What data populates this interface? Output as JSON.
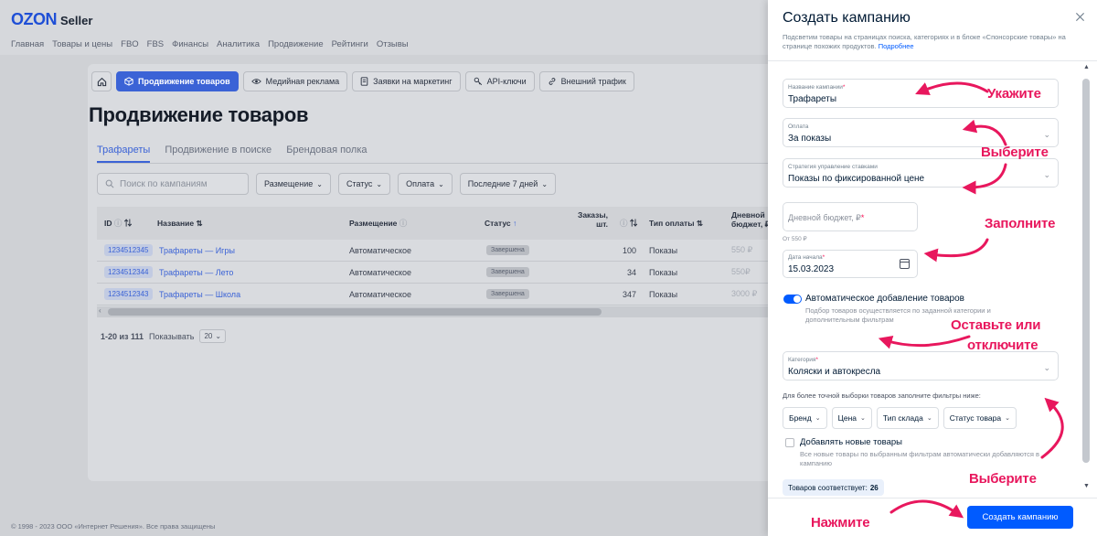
{
  "logo": {
    "brand": "OZON",
    "product": "Seller"
  },
  "top_nav": [
    "Главная",
    "Товары и цены",
    "FBO",
    "FBS",
    "Финансы",
    "Аналитика",
    "Продвижение",
    "Рейтинги",
    "Отзывы"
  ],
  "sub_nav": {
    "items": [
      "Продвижение товаров",
      "Медийная реклама",
      "Заявки на маркетинг",
      "API-ключи",
      "Внешний трафик"
    ]
  },
  "page_title": "Продвижение товаров",
  "tabs": [
    "Трафареты",
    "Продвижение в поиске",
    "Брендовая полка"
  ],
  "filters": {
    "search_placeholder": "Поиск по кампаниям",
    "buttons": [
      "Размещение",
      "Статус",
      "Оплата",
      "Последние 7 дней"
    ]
  },
  "table": {
    "headers": {
      "id": "ID",
      "name": "Название",
      "placement": "Размещение",
      "status": "Статус",
      "orders_l1": "Заказы,",
      "orders_l2": "шт.",
      "pay_type": "Тип оплаты",
      "budget_l1": "Дневной",
      "budget_l2": "бюджет, ₽"
    },
    "rows": [
      {
        "id": "1234512345",
        "name": "Трафареты — Игры",
        "placement": "Автоматическое",
        "status": "Завершена",
        "orders": "100",
        "pay_type": "Показы",
        "budget": "550 ₽"
      },
      {
        "id": "1234512344",
        "name": "Трафареты — Лето",
        "placement": "Автоматическое",
        "status": "Завершена",
        "orders": "34",
        "pay_type": "Показы",
        "budget": "550₽"
      },
      {
        "id": "1234512343",
        "name": "Трафареты — Школа",
        "placement": "Автоматическое",
        "status": "Завершена",
        "orders": "347",
        "pay_type": "Показы",
        "budget": "3000 ₽"
      }
    ]
  },
  "pager": {
    "range": "1-20 из 111",
    "show_label": "Показывать",
    "page_size": "20"
  },
  "footer": "© 1998 - 2023 ООО «Интернет Решения». Все права защищены",
  "drawer": {
    "title": "Создать кампанию",
    "description": "Подсветим товары на страницах поиска, категориях и в блоке «Спонсорские товары» на странице похожих продуктов.",
    "more_link": "Подробнее",
    "campaign_name": {
      "label": "Название кампании",
      "value": "Трафареты"
    },
    "payment": {
      "label": "Оплата",
      "value": "За показы"
    },
    "strategy": {
      "label": "Стратегия управление ставками",
      "value": "Показы по фиксированной цене"
    },
    "budget": {
      "placeholder": "Дневной бюджет, ₽",
      "hint": "От 550 ₽"
    },
    "start_date": {
      "label": "Дата начала",
      "value": "15.03.2023"
    },
    "auto_add": {
      "label": "Автоматическое добавление товаров",
      "description": "Подбор товаров осуществляется по заданной категории и дополнительным фильтрам",
      "enabled": true
    },
    "category": {
      "label": "Категория",
      "value": "Коляски и автокресла"
    },
    "filters_hint": "Для более точной выборки товаров заполните фильтры ниже:",
    "filter_buttons": [
      "Бренд",
      "Цена",
      "Тип склада",
      "Статус товара"
    ],
    "add_new": {
      "label": "Добавлять новые товары",
      "description": "Все новые товары по выбранным фильтрам автоматически добавляются в кампанию",
      "checked": false
    },
    "matches": {
      "label": "Товаров соответствует:",
      "count": "26"
    },
    "create_button": "Создать кампанию"
  },
  "annotations": [
    "Укажите",
    "Выберите",
    "Заполните",
    "Оставьте или",
    "отключите",
    "Выберите",
    "Нажмите"
  ],
  "colors": {
    "accent": "#005bff",
    "annotation": "#e8175d",
    "required": "#f91155"
  },
  "icons": [
    "home-icon",
    "box-icon",
    "eye-icon",
    "document-icon",
    "key-icon",
    "link-icon",
    "search-icon",
    "calendar-icon",
    "close-icon",
    "chevron-down-icon"
  ]
}
